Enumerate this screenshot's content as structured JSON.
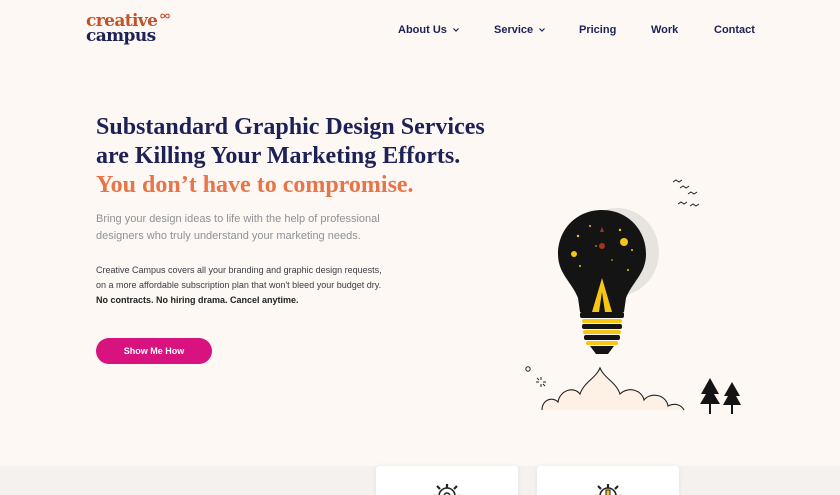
{
  "logo": {
    "line1": "creative",
    "line2": "campus"
  },
  "nav": {
    "items": [
      {
        "label": "About Us",
        "has_dropdown": true
      },
      {
        "label": "Service",
        "has_dropdown": true
      },
      {
        "label": "Pricing",
        "has_dropdown": false
      },
      {
        "label": "Work",
        "has_dropdown": false
      },
      {
        "label": "Contact",
        "has_dropdown": false
      }
    ]
  },
  "hero": {
    "title_line1": "Substandard Graphic Design Services",
    "title_line2": "are Killing Your Marketing Efforts.",
    "title_accent": "You don’t have to compromise.",
    "lead_line1": "Bring your design ideas to life with the help of professional",
    "lead_line2": "designers who truly understand your marketing needs.",
    "body_line1": "Creative Campus covers all your branding and graphic design requests,",
    "body_line2": "on a more affordable subscription plan that won't bleed your budget dry.",
    "body_strong": "No contracts. No hiring drama. Cancel anytime.",
    "cta_label": "Show Me How"
  },
  "colors": {
    "background": "#fdf8f3",
    "navy": "#1d2158",
    "accent_orange": "#e8744a",
    "cta_pink": "#d8127e",
    "bulb_yellow": "#f6c515"
  },
  "icons": {
    "illustration": "lightbulb-rocket-illustration",
    "card1": "gear-icon",
    "card2": "gear-pencil-icon"
  }
}
